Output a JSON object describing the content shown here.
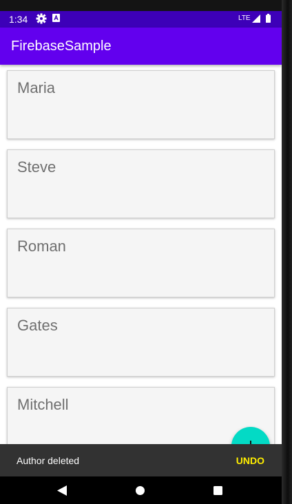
{
  "status_bar": {
    "time": "1:34",
    "network": "LTE",
    "icons": [
      "gear-icon",
      "a-notification-icon",
      "signal-icon",
      "battery-icon"
    ]
  },
  "app_bar": {
    "title": "FirebaseSample",
    "color": "#6200ee",
    "status_color": "#3d00b8"
  },
  "authors": [
    {
      "name": "Maria"
    },
    {
      "name": "Steve"
    },
    {
      "name": "Roman"
    },
    {
      "name": "Gates"
    },
    {
      "name": "Mitchell"
    }
  ],
  "fab": {
    "icon": "plus-icon",
    "color": "#03dac5"
  },
  "snackbar": {
    "message": "Author deleted",
    "action": "UNDO",
    "action_color": "#ffee00"
  },
  "nav_bar": {
    "icons": [
      "back-icon",
      "home-icon",
      "recents-icon"
    ]
  }
}
